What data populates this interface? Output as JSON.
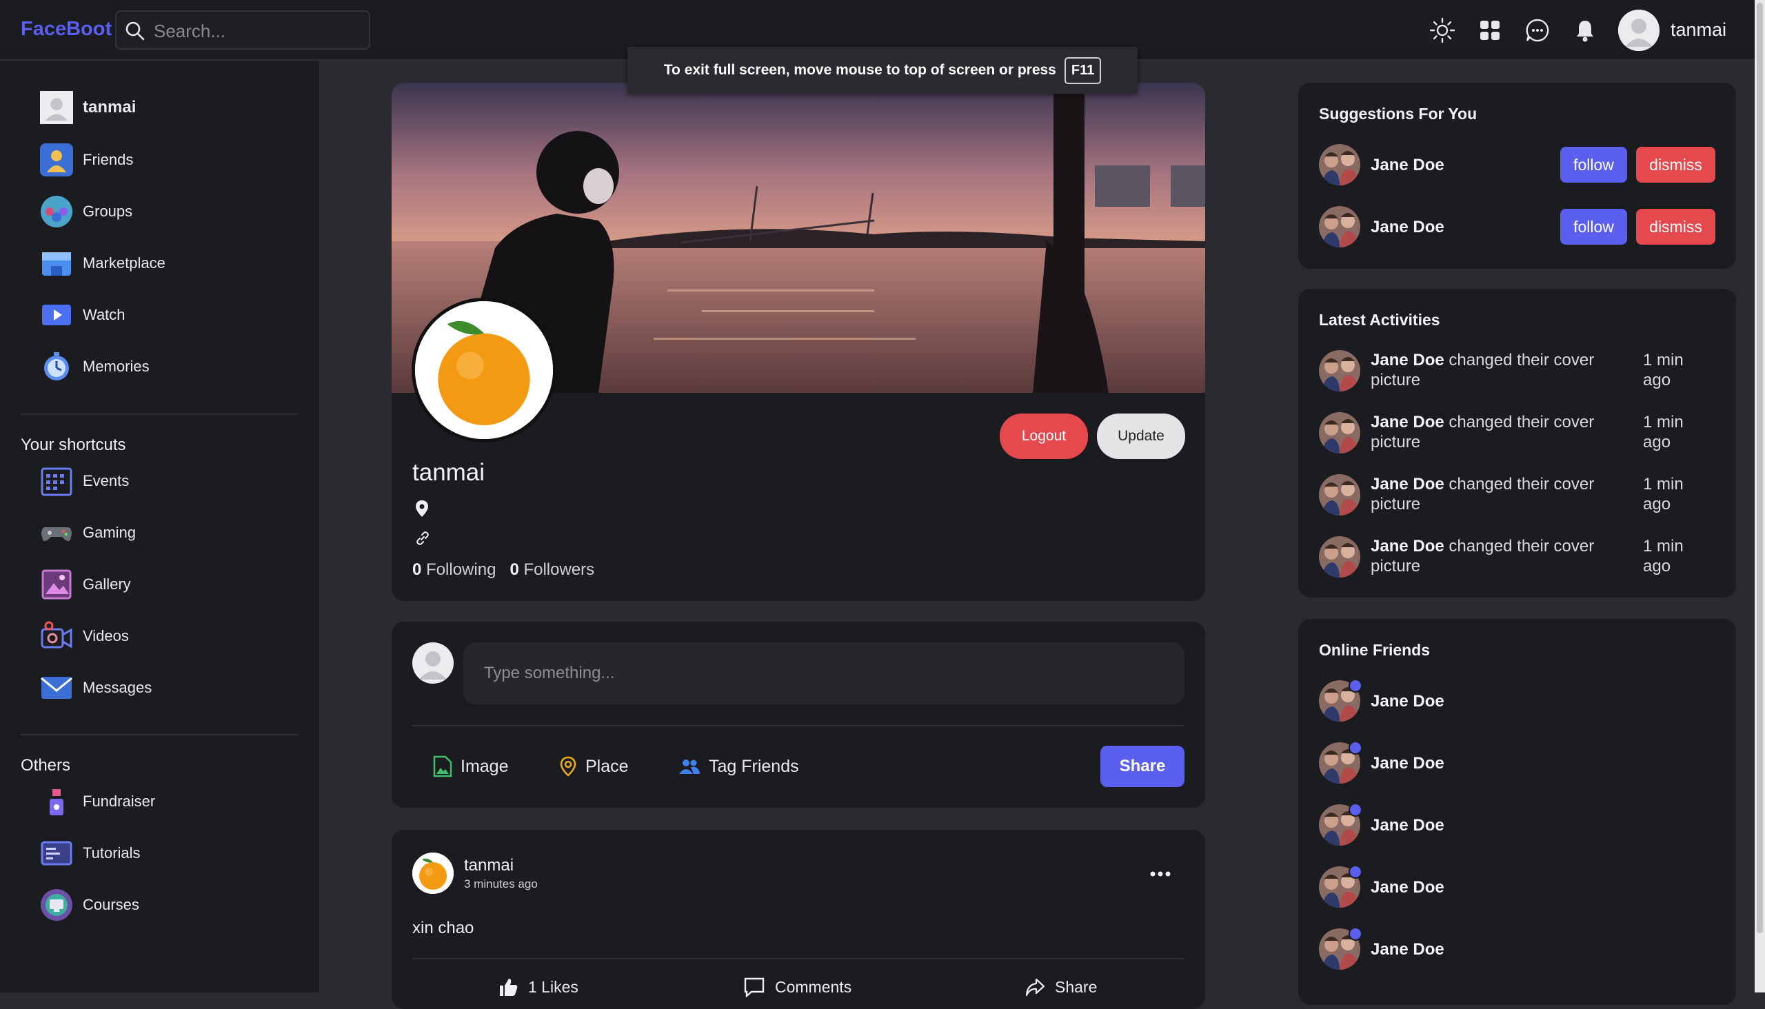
{
  "navbar": {
    "brand": "FaceBoot",
    "search_placeholder": "Search...",
    "username": "tanmai",
    "icons": [
      "sun-icon",
      "grid-icon",
      "chat-icon",
      "bell-icon"
    ]
  },
  "fullscreen_notice": {
    "text": "To exit full screen, move mouse to top of screen or press",
    "key": "F11"
  },
  "sidebar": {
    "user": "tanmai",
    "main_items": [
      {
        "label": "Friends",
        "icon": "friends-icon"
      },
      {
        "label": "Groups",
        "icon": "groups-icon"
      },
      {
        "label": "Marketplace",
        "icon": "marketplace-icon"
      },
      {
        "label": "Watch",
        "icon": "watch-icon"
      },
      {
        "label": "Memories",
        "icon": "memories-icon"
      }
    ],
    "shortcuts_title": "Your shortcuts",
    "shortcuts": [
      {
        "label": "Events",
        "icon": "events-icon"
      },
      {
        "label": "Gaming",
        "icon": "gaming-icon"
      },
      {
        "label": "Gallery",
        "icon": "gallery-icon"
      },
      {
        "label": "Videos",
        "icon": "videos-icon"
      },
      {
        "label": "Messages",
        "icon": "messages-icon"
      }
    ],
    "others_title": "Others",
    "others": [
      {
        "label": "Fundraiser",
        "icon": "fundraiser-icon"
      },
      {
        "label": "Tutorials",
        "icon": "tutorials-icon"
      },
      {
        "label": "Courses",
        "icon": "courses-icon"
      }
    ]
  },
  "profile": {
    "name": "tanmai",
    "logout_label": "Logout",
    "update_label": "Update",
    "following_count": "0",
    "following_label": "Following",
    "followers_count": "0",
    "followers_label": "Followers"
  },
  "composer": {
    "placeholder": "Type something...",
    "image_label": "Image",
    "place_label": "Place",
    "tag_label": "Tag Friends",
    "share_label": "Share"
  },
  "post": {
    "author": "tanmai",
    "time": "3 minutes ago",
    "text": "xin chao",
    "likes_label": "1 Likes",
    "comments_label": "Comments",
    "share_label": "Share"
  },
  "suggestions": {
    "title": "Suggestions For You",
    "follow_label": "follow",
    "dismiss_label": "dismiss",
    "items": [
      {
        "name": "Jane Doe"
      },
      {
        "name": "Jane Doe"
      }
    ]
  },
  "activities": {
    "title": "Latest Activities",
    "items": [
      {
        "name": "Jane Doe",
        "text": "changed their cover picture",
        "time": "1 min ago"
      },
      {
        "name": "Jane Doe",
        "text": "changed their cover picture",
        "time": "1 min ago"
      },
      {
        "name": "Jane Doe",
        "text": "changed their cover picture",
        "time": "1 min ago"
      },
      {
        "name": "Jane Doe",
        "text": "changed their cover picture",
        "time": "1 min ago"
      }
    ]
  },
  "online": {
    "title": "Online Friends",
    "items": [
      {
        "name": "Jane Doe"
      },
      {
        "name": "Jane Doe"
      },
      {
        "name": "Jane Doe"
      },
      {
        "name": "Jane Doe"
      },
      {
        "name": "Jane Doe"
      }
    ]
  },
  "colors": {
    "accent": "#5b5ff0",
    "danger": "#e5484d",
    "panel": "#1b1c20",
    "background": "#2a2b30"
  }
}
